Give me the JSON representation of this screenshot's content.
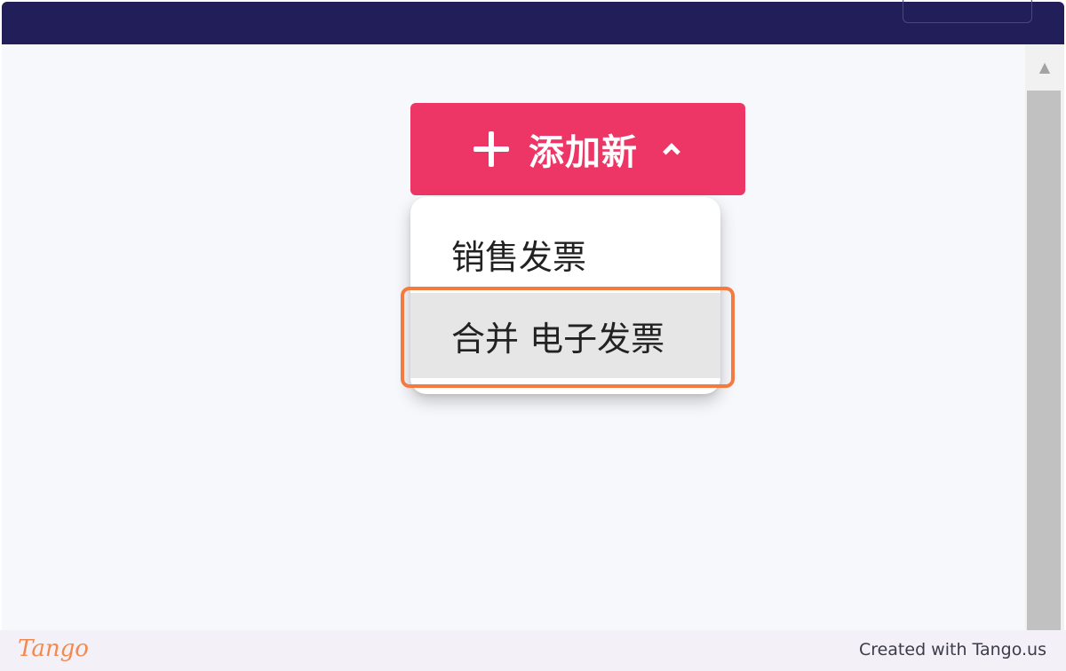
{
  "add_button": {
    "label": "添加新",
    "plus_icon": "plus-icon",
    "chevron_icon": "chevron-up-icon",
    "color": "#ee3666"
  },
  "dropdown": {
    "items": [
      {
        "label": "销售发票"
      },
      {
        "label": "合并 电子发票"
      }
    ],
    "highlight_color": "#f47a40"
  },
  "scrollbar": {
    "up_icon": "triangle-up-icon"
  },
  "footer": {
    "logo": "Tango",
    "credit": "Created with Tango.us"
  },
  "colors": {
    "header": "#211e5a",
    "background": "#f7f8fc"
  }
}
